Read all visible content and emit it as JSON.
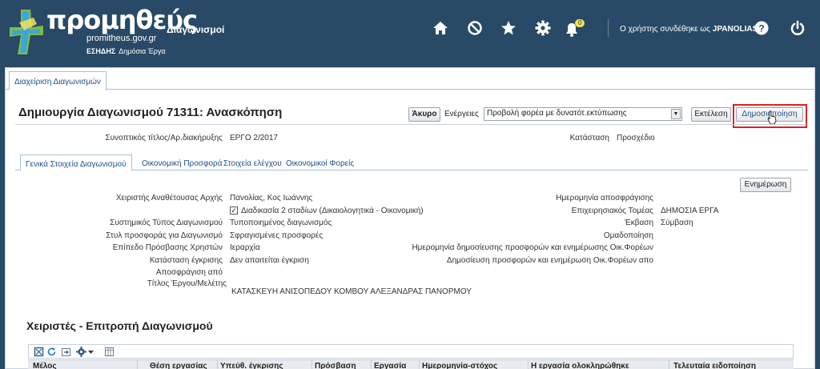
{
  "header": {
    "logo_title": "προμηθεύς",
    "logo_domain": "promitheus.gov.gr",
    "logo_org": "ΕΣΗΔΗΣ",
    "logo_sub": "Δημόσια Έργα",
    "app_title": "Διαγωνισμοί",
    "notifications_count": "0",
    "user_prefix": "Ο χρήστης συνδέθηκε ως",
    "user_name": "JPANOLIAS",
    "icons": [
      "home-icon",
      "blocked-icon",
      "star-icon",
      "gear-icon",
      "bell-icon",
      "help-icon",
      "power-icon"
    ]
  },
  "top_tab": {
    "label": "Διαχείριση Διαγωνισμών"
  },
  "page": {
    "title": "Δημιουργία Διαγωνισμού 71311: Ανασκόπηση",
    "cancel_button": "Άκυρο",
    "actions_label": "Ενέργειες",
    "actions_selected": "Προβολή φορέα με δυνατότ.εκτύπωσης",
    "execute_button": "Εκτέλεση",
    "publish_button": "Δημοσιοποίηση"
  },
  "summary": {
    "short_title_label": "Συνοπτικός τίτλος/Αρ.διακήρυξης",
    "short_title_value": "ΕΡΓΟ 2/2017",
    "status_label": "Κατάσταση",
    "status_value": "Προσχέδιο"
  },
  "tabs": [
    {
      "label": "Γενικά Στοιχεία Διαγωνισμού",
      "active": true
    },
    {
      "label": "Οικονομική Προσφορά",
      "active": false
    },
    {
      "label": "Στοιχεία ελέγχου",
      "active": false
    },
    {
      "label": "Οικονομικοί Φορείς",
      "active": false
    }
  ],
  "update_button": "Ενημέρωση",
  "general": {
    "left": [
      {
        "label": "Χειριστής Αναθέτουσας Αρχής",
        "value": "Πανολίας, Κος Ιωάννης"
      },
      {
        "label": "",
        "value": "Διαδικασία 2 σταδίων (Δικαιολογητικά - Οικονομική)"
      },
      {
        "label": "Συστημικός Τύπος Διαγωνισμού",
        "value": "Τυποποιημένος διαγωνισμός"
      },
      {
        "label": "Στυλ προσφοράς για Διαγωνισμό",
        "value": "Σφραγισμένες προσφορές"
      },
      {
        "label": "Επίπεδο Πρόσβασης Χρηστών",
        "value": "Ιεραρχία"
      },
      {
        "label": "Κατάσταση έγκρισης",
        "value": "Δεν απαιτείται έγκριση"
      },
      {
        "label": "Αποσφράγιση από",
        "value": ""
      },
      {
        "label": "Τίτλος Έργου/Μελέτης",
        "value": "ΚΑΤΑΣΚΕΥΗ ΑΝΙΣΟΠΕΔΟΥ ΚΟΜΒΟΥ ΑΛΕΞΑΝΔΡΑΣ ΠΑΝΟΡΜΟΥ"
      }
    ],
    "right": [
      {
        "label": "Ημερομηνία αποσφράγισης",
        "value": ""
      },
      {
        "label": "Επιχειρησιακός Τομέας",
        "value": "ΔΗΜΟΣΙΑ ΕΡΓΑ"
      },
      {
        "label": "Έκβαση",
        "value": "Σύμβαση"
      },
      {
        "label": "Ομαδοποίηση",
        "value": ""
      },
      {
        "label": "Ημερομηνία δημοσίευσης προσφορών και ενημέρωσης Οικ.Φορέων",
        "value": ""
      },
      {
        "label": "Δημοσίευση προσφορών και ενημέρωση Οικ.Φορέων απο",
        "value": ""
      }
    ]
  },
  "committee": {
    "title": "Χειριστές - Επιτροπή Διαγωνισμού",
    "columns": [
      "Μέλος",
      "Θέση εργασίας",
      "Υπεύθ. έγκρισης",
      "Πρόσβαση",
      "Εργασία",
      "Ημερομηνία-στόχος",
      "Η εργασία ολοκληρώθηκε",
      "Τελευταία ειδοποίηση"
    ]
  }
}
